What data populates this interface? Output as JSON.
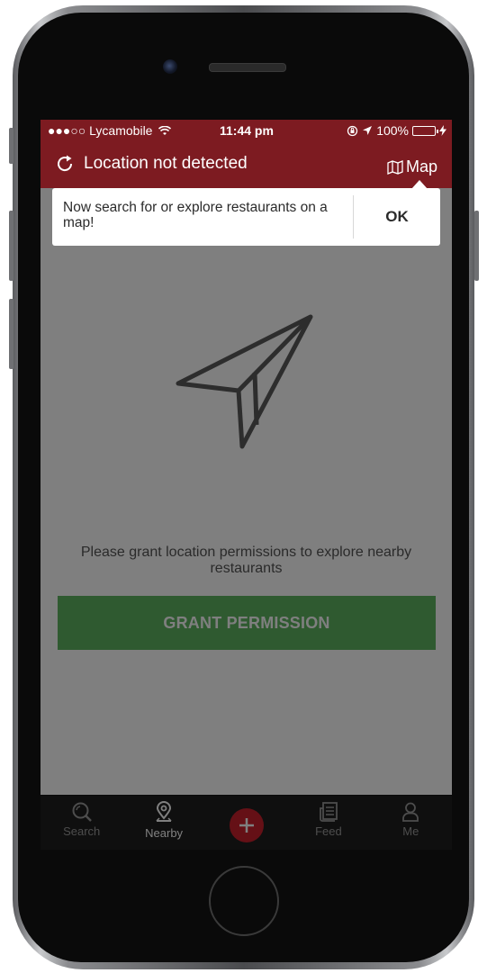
{
  "status_bar": {
    "carrier": "●●●○○ Lycamobile",
    "time": "11:44 pm",
    "battery": "100%"
  },
  "header": {
    "title": "Location not detected",
    "map_label": "Map"
  },
  "content": {
    "permission_text": "Please grant location permissions to explore nearby restaurants",
    "grant_button": "GRANT PERMISSION"
  },
  "tooltip": {
    "message": "Now search for or explore restaurants on a map!",
    "ok_label": "OK"
  },
  "tab_bar": {
    "tabs": [
      {
        "label": "Search",
        "icon": "search-icon",
        "active": false
      },
      {
        "label": "Nearby",
        "icon": "location-pin-icon",
        "active": true
      },
      {
        "label": "",
        "icon": "plus-icon",
        "active": false
      },
      {
        "label": "Feed",
        "icon": "feed-icon",
        "active": false
      },
      {
        "label": "Me",
        "icon": "person-icon",
        "active": false
      }
    ]
  },
  "colors": {
    "brand": "#7d1b21",
    "accent_green": "#5eb561",
    "add_button": "#cb202d"
  }
}
